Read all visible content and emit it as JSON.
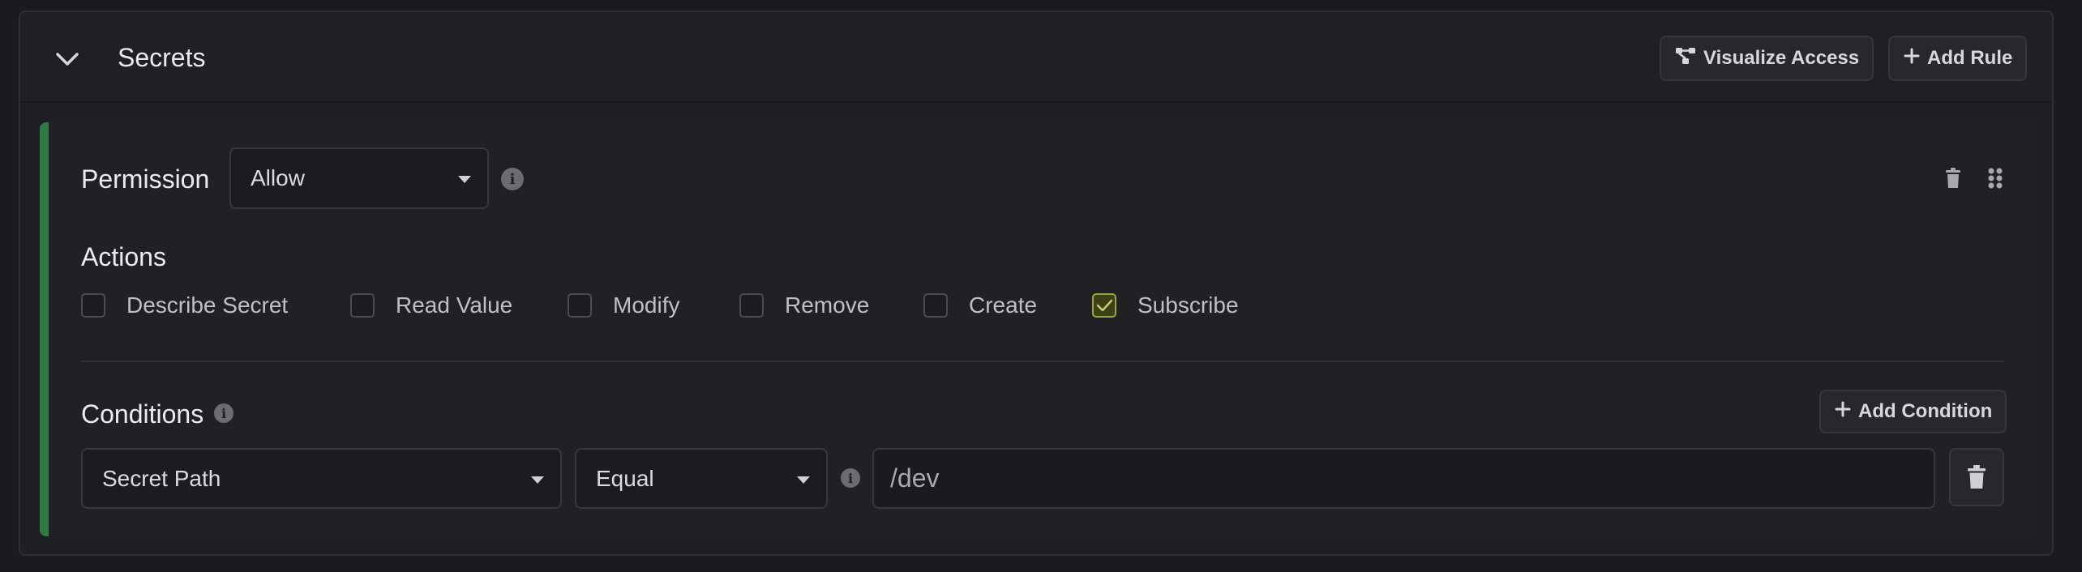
{
  "section": {
    "title": "Secrets",
    "buttons": {
      "visualize_label": "Visualize Access",
      "add_rule_label": "Add Rule"
    }
  },
  "rule": {
    "permission_label": "Permission",
    "permission_value": "Allow",
    "actions_label": "Actions",
    "actions": [
      {
        "label": "Describe Secret",
        "checked": false
      },
      {
        "label": "Read Value",
        "checked": false
      },
      {
        "label": "Modify",
        "checked": false
      },
      {
        "label": "Remove",
        "checked": false
      },
      {
        "label": "Create",
        "checked": false
      },
      {
        "label": "Subscribe",
        "checked": true
      }
    ],
    "conditions_label": "Conditions",
    "add_condition_label": "Add Condition",
    "condition": {
      "field": "Secret Path",
      "operator": "Equal",
      "value": "/dev"
    }
  },
  "colors": {
    "accent_green": "#2f7a47",
    "checked_border": "#9aa53a"
  },
  "icons": {
    "collapse": "chevron-down-icon",
    "visualize": "graph-icon",
    "add": "plus-icon",
    "info": "info-icon",
    "delete": "trash-icon",
    "drag": "drag-handle-icon",
    "check": "checkmark-icon"
  }
}
